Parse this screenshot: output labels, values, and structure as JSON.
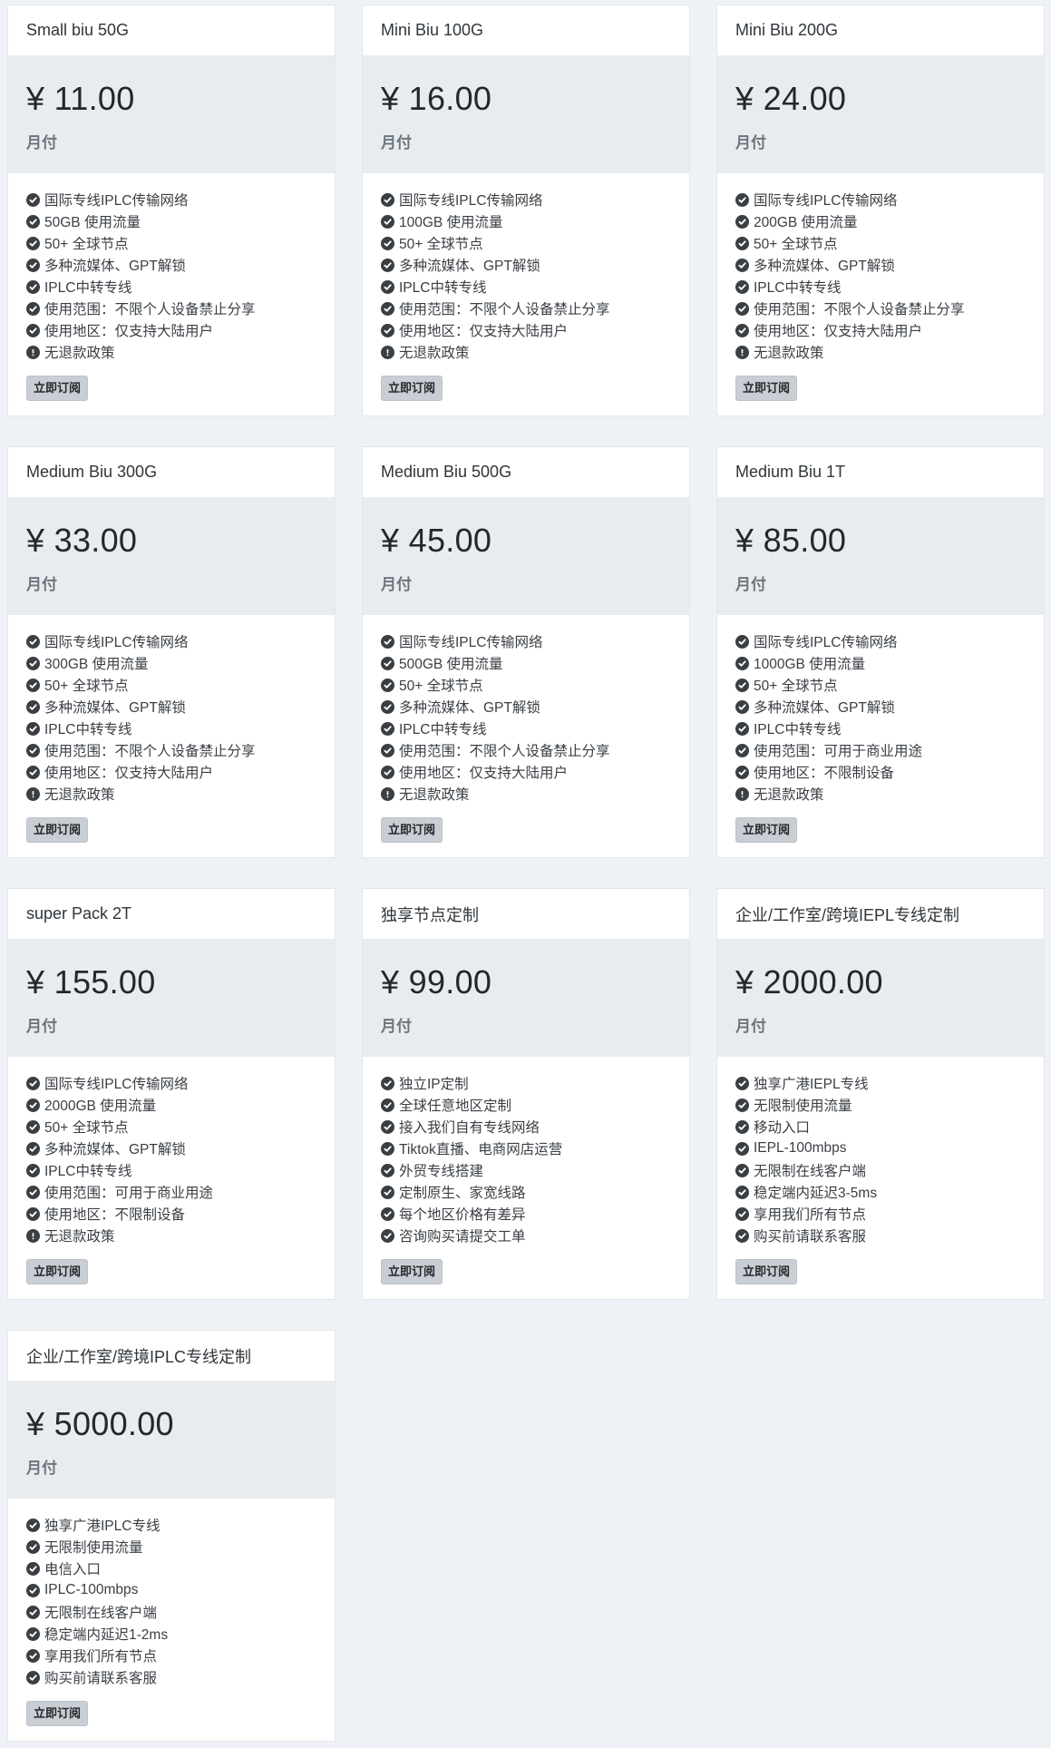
{
  "plans": [
    {
      "name": "Small biu 50G",
      "price": "¥ 11.00",
      "period": "月付",
      "button_label": "立即订阅",
      "features": [
        {
          "icon": "check-circle-icon",
          "text": "国际专线IPLC传输网络"
        },
        {
          "icon": "check-circle-icon",
          "text": "50GB 使用流量"
        },
        {
          "icon": "check-circle-icon",
          "text": "50+ 全球节点"
        },
        {
          "icon": "check-circle-icon",
          "text": "多种流媒体、GPT解锁"
        },
        {
          "icon": "check-circle-icon",
          "text": "IPLC中转专线"
        },
        {
          "icon": "check-circle-icon",
          "text": "使用范围：不限个人设备禁止分享"
        },
        {
          "icon": "check-circle-icon",
          "text": "使用地区：仅支持大陆用户"
        },
        {
          "icon": "exclamation-circle-icon",
          "text": "无退款政策"
        }
      ]
    },
    {
      "name": "Mini Biu 100G",
      "price": "¥ 16.00",
      "period": "月付",
      "button_label": "立即订阅",
      "features": [
        {
          "icon": "check-circle-icon",
          "text": "国际专线IPLC传输网络"
        },
        {
          "icon": "check-circle-icon",
          "text": "100GB 使用流量"
        },
        {
          "icon": "check-circle-icon",
          "text": "50+ 全球节点"
        },
        {
          "icon": "check-circle-icon",
          "text": "多种流媒体、GPT解锁"
        },
        {
          "icon": "check-circle-icon",
          "text": "IPLC中转专线"
        },
        {
          "icon": "check-circle-icon",
          "text": "使用范围：不限个人设备禁止分享"
        },
        {
          "icon": "check-circle-icon",
          "text": "使用地区：仅支持大陆用户"
        },
        {
          "icon": "exclamation-circle-icon",
          "text": "无退款政策"
        }
      ]
    },
    {
      "name": "Mini Biu 200G",
      "price": "¥ 24.00",
      "period": "月付",
      "button_label": "立即订阅",
      "features": [
        {
          "icon": "check-circle-icon",
          "text": "国际专线IPLC传输网络"
        },
        {
          "icon": "check-circle-icon",
          "text": "200GB 使用流量"
        },
        {
          "icon": "check-circle-icon",
          "text": "50+ 全球节点"
        },
        {
          "icon": "check-circle-icon",
          "text": "多种流媒体、GPT解锁"
        },
        {
          "icon": "check-circle-icon",
          "text": "IPLC中转专线"
        },
        {
          "icon": "check-circle-icon",
          "text": "使用范围：不限个人设备禁止分享"
        },
        {
          "icon": "check-circle-icon",
          "text": "使用地区：仅支持大陆用户"
        },
        {
          "icon": "exclamation-circle-icon",
          "text": "无退款政策"
        }
      ]
    },
    {
      "name": "Medium Biu 300G",
      "price": "¥ 33.00",
      "period": "月付",
      "button_label": "立即订阅",
      "features": [
        {
          "icon": "check-circle-icon",
          "text": "国际专线IPLC传输网络"
        },
        {
          "icon": "check-circle-icon",
          "text": "300GB 使用流量"
        },
        {
          "icon": "check-circle-icon",
          "text": "50+ 全球节点"
        },
        {
          "icon": "check-circle-icon",
          "text": "多种流媒体、GPT解锁"
        },
        {
          "icon": "check-circle-icon",
          "text": "IPLC中转专线"
        },
        {
          "icon": "check-circle-icon",
          "text": "使用范围：不限个人设备禁止分享"
        },
        {
          "icon": "check-circle-icon",
          "text": "使用地区：仅支持大陆用户"
        },
        {
          "icon": "exclamation-circle-icon",
          "text": "无退款政策"
        }
      ]
    },
    {
      "name": "Medium Biu 500G",
      "price": "¥ 45.00",
      "period": "月付",
      "button_label": "立即订阅",
      "features": [
        {
          "icon": "check-circle-icon",
          "text": "国际专线IPLC传输网络"
        },
        {
          "icon": "check-circle-icon",
          "text": "500GB 使用流量"
        },
        {
          "icon": "check-circle-icon",
          "text": "50+ 全球节点"
        },
        {
          "icon": "check-circle-icon",
          "text": "多种流媒体、GPT解锁"
        },
        {
          "icon": "check-circle-icon",
          "text": "IPLC中转专线"
        },
        {
          "icon": "check-circle-icon",
          "text": "使用范围：不限个人设备禁止分享"
        },
        {
          "icon": "check-circle-icon",
          "text": "使用地区：仅支持大陆用户"
        },
        {
          "icon": "exclamation-circle-icon",
          "text": "无退款政策"
        }
      ]
    },
    {
      "name": "Medium Biu 1T",
      "price": "¥ 85.00",
      "period": "月付",
      "button_label": "立即订阅",
      "features": [
        {
          "icon": "check-circle-icon",
          "text": "国际专线IPLC传输网络"
        },
        {
          "icon": "check-circle-icon",
          "text": "1000GB 使用流量"
        },
        {
          "icon": "check-circle-icon",
          "text": "50+ 全球节点"
        },
        {
          "icon": "check-circle-icon",
          "text": "多种流媒体、GPT解锁"
        },
        {
          "icon": "check-circle-icon",
          "text": "IPLC中转专线"
        },
        {
          "icon": "check-circle-icon",
          "text": "使用范围：可用于商业用途"
        },
        {
          "icon": "check-circle-icon",
          "text": "使用地区：不限制设备"
        },
        {
          "icon": "exclamation-circle-icon",
          "text": "无退款政策"
        }
      ]
    },
    {
      "name": "super Pack 2T",
      "price": "¥ 155.00",
      "period": "月付",
      "button_label": "立即订阅",
      "features": [
        {
          "icon": "check-circle-icon",
          "text": "国际专线IPLC传输网络"
        },
        {
          "icon": "check-circle-icon",
          "text": "2000GB 使用流量"
        },
        {
          "icon": "check-circle-icon",
          "text": "50+ 全球节点"
        },
        {
          "icon": "check-circle-icon",
          "text": "多种流媒体、GPT解锁"
        },
        {
          "icon": "check-circle-icon",
          "text": "IPLC中转专线"
        },
        {
          "icon": "check-circle-icon",
          "text": "使用范围：可用于商业用途"
        },
        {
          "icon": "check-circle-icon",
          "text": "使用地区：不限制设备"
        },
        {
          "icon": "exclamation-circle-icon",
          "text": "无退款政策"
        }
      ]
    },
    {
      "name": "独享节点定制",
      "price": "¥ 99.00",
      "period": "月付",
      "button_label": "立即订阅",
      "features": [
        {
          "icon": "check-circle-icon",
          "text": "独立IP定制"
        },
        {
          "icon": "check-circle-icon",
          "text": "全球任意地区定制"
        },
        {
          "icon": "check-circle-icon",
          "text": "接入我们自有专线网络"
        },
        {
          "icon": "check-circle-icon",
          "text": "Tiktok直播、电商网店运营"
        },
        {
          "icon": "check-circle-icon",
          "text": "外贸专线搭建"
        },
        {
          "icon": "check-circle-icon",
          "text": "定制原生、家宽线路"
        },
        {
          "icon": "check-circle-icon",
          "text": "每个地区价格有差异"
        },
        {
          "icon": "check-circle-icon",
          "text": "咨询购买请提交工单"
        }
      ]
    },
    {
      "name": "企业/工作室/跨境IEPL专线定制",
      "price": "¥ 2000.00",
      "period": "月付",
      "button_label": "立即订阅",
      "features": [
        {
          "icon": "check-circle-icon",
          "text": "独享广港IEPL专线"
        },
        {
          "icon": "check-circle-icon",
          "text": "无限制使用流量"
        },
        {
          "icon": "check-circle-icon",
          "text": "移动入口"
        },
        {
          "icon": "check-circle-icon",
          "text": "IEPL-100mbps"
        },
        {
          "icon": "check-circle-icon",
          "text": "无限制在线客户端"
        },
        {
          "icon": "check-circle-icon",
          "text": "稳定端内延迟3-5ms"
        },
        {
          "icon": "check-circle-icon",
          "text": "享用我们所有节点"
        },
        {
          "icon": "check-circle-icon",
          "text": "购买前请联系客服"
        }
      ]
    },
    {
      "name": "企业/工作室/跨境IPLC专线定制",
      "price": "¥ 5000.00",
      "period": "月付",
      "button_label": "立即订阅",
      "features": [
        {
          "icon": "check-circle-icon",
          "text": "独享广港IPLC专线"
        },
        {
          "icon": "check-circle-icon",
          "text": "无限制使用流量"
        },
        {
          "icon": "check-circle-icon",
          "text": "电信入口"
        },
        {
          "icon": "check-circle-icon",
          "text": "IPLC-100mbps"
        },
        {
          "icon": "check-circle-icon",
          "text": "无限制在线客户端"
        },
        {
          "icon": "check-circle-icon",
          "text": "稳定端内延迟1-2ms"
        },
        {
          "icon": "check-circle-icon",
          "text": "享用我们所有节点"
        },
        {
          "icon": "check-circle-icon",
          "text": "购买前请联系客服"
        }
      ]
    }
  ],
  "colors": {
    "page_background": "#eef1f6",
    "card_background": "#ffffff",
    "price_background": "#e9ecef",
    "button_background": "#c8ced3",
    "icon_color": "#3a3f44"
  }
}
